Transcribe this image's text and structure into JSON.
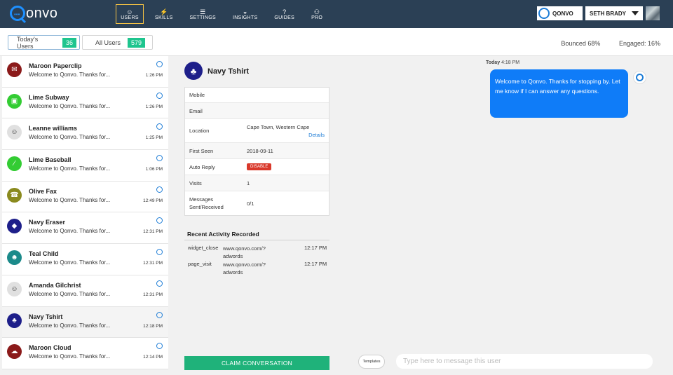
{
  "nav": {
    "logo": "onvo",
    "items": [
      {
        "label": "USERS",
        "icon": "users-icon",
        "glyph": "☺"
      },
      {
        "label": "SKILLS",
        "icon": "bolt-icon",
        "glyph": "⚡"
      },
      {
        "label": "SETTINGS",
        "icon": "sliders-icon",
        "glyph": "☰"
      },
      {
        "label": "INSIGHTS",
        "icon": "gauge-icon",
        "glyph": "◒"
      },
      {
        "label": "GUIDES",
        "icon": "help-icon",
        "glyph": "?"
      },
      {
        "label": "PRO",
        "icon": "nodes-icon",
        "glyph": "⚇"
      }
    ],
    "org_name": "QONVO",
    "user_name": "SETH BRADY"
  },
  "subheader": {
    "today_label": "Today's Users",
    "today_count": "36",
    "all_label": "All Users",
    "all_count": "579",
    "bounced": "Bounced 68%",
    "engaged": "Engaged: 16%"
  },
  "users": [
    {
      "name": "Maroon Paperclip",
      "msg": "Welcome to Qonvo. Thanks for...",
      "time": "1:26 PM",
      "color": "#8b1a1a",
      "glyph": "✉"
    },
    {
      "name": "Lime Subway",
      "msg": "Welcome to Qonvo. Thanks for...",
      "time": "1:26 PM",
      "color": "#33cc33",
      "glyph": "▣"
    },
    {
      "name": "Leanne williams",
      "msg": "Welcome to Qonvo. Thanks for...",
      "time": "1:25 PM",
      "color": "#e0e0e0",
      "glyph": "☺"
    },
    {
      "name": "Lime Baseball",
      "msg": "Welcome to Qonvo. Thanks for...",
      "time": "1:06 PM",
      "color": "#33cc33",
      "glyph": "∕"
    },
    {
      "name": "Olive Fax",
      "msg": "Welcome to Qonvo. Thanks for...",
      "time": "12:49 PM",
      "color": "#8a8a1e",
      "glyph": "☎"
    },
    {
      "name": "Navy Eraser",
      "msg": "Welcome to Qonvo. Thanks for...",
      "time": "12:31 PM",
      "color": "#1e1f8a",
      "glyph": "◆"
    },
    {
      "name": "Teal Child",
      "msg": "Welcome to Qonvo. Thanks for...",
      "time": "12:31 PM",
      "color": "#1b8a8a",
      "glyph": "☻"
    },
    {
      "name": "Amanda Gilchrist",
      "msg": "Welcome to Qonvo. Thanks for...",
      "time": "12:31 PM",
      "color": "#e0e0e0",
      "glyph": "☺"
    },
    {
      "name": "Navy Tshirt",
      "msg": "Welcome to Qonvo. Thanks for...",
      "time": "12:18 PM",
      "color": "#1e1f8a",
      "glyph": "♣"
    },
    {
      "name": "Maroon Cloud",
      "msg": "Welcome to Qonvo. Thanks for...",
      "time": "12:14 PM",
      "color": "#8b1a1a",
      "glyph": "☁"
    }
  ],
  "profile": {
    "name": "Navy Tshirt",
    "rows": [
      {
        "label": "Mobile",
        "value": ""
      },
      {
        "label": "Email",
        "value": ""
      },
      {
        "label": "Location",
        "value": "Cape Town, Western Cape",
        "link": "Details"
      },
      {
        "label": "First Seen",
        "value": "2018-09-11"
      },
      {
        "label": "Auto Reply",
        "value": "DISABLE"
      },
      {
        "label": "Visits",
        "value": "1"
      },
      {
        "label": "Messages Sent/Received",
        "value": "0/1"
      }
    ]
  },
  "activity": {
    "title": "Recent Activity Recorded",
    "items": [
      {
        "event": "widget_close",
        "url": "www.qonvo.com/?",
        "url2": "adwords",
        "time": "12:17 PM"
      },
      {
        "event": "page_visit",
        "url": "www.qonvo.com/?",
        "url2": "adwords",
        "time": "12:17 PM"
      }
    ]
  },
  "chat": {
    "day": "Today",
    "time": "4:18 PM",
    "message": "Welcome to Qonvo. Thanks for stopping by. Let me know if I can answer any questions."
  },
  "actions": {
    "claim": "CLAIM CONVERSATION",
    "templates": "Templates",
    "input_placeholder": "Type here to message this user"
  }
}
